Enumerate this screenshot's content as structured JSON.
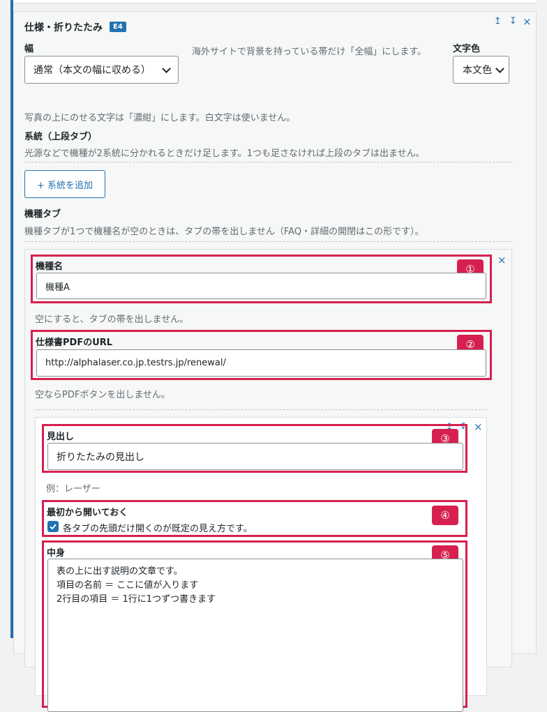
{
  "block": {
    "title": "仕様・折りたたみ",
    "badge": "E4",
    "controls": {
      "up": "↥",
      "down": "↧",
      "close": "×"
    }
  },
  "width_field": {
    "label": "幅",
    "value": "通常（本文の幅に収める）",
    "hint": "海外サイトで背景を持っている帯だけ「全幅」にします。"
  },
  "text_color_field": {
    "label": "文字色",
    "value": "本文色"
  },
  "photo_note": "写真の上にのせる文字は「濃紺」にします。白文字は使いません。",
  "system_section": {
    "label": "系統（上段タブ）",
    "desc": "光源などで機種が2系統に分かれるときだけ足します。1つも足さなければ上段のタブは出ません。",
    "add_button": "+ 系統を追加"
  },
  "model_tabs": {
    "label": "機種タブ",
    "desc": "機種タブが1つで機種名が空のときは、タブの帯を出しません（FAQ・詳細の開閉はこの形です）。"
  },
  "model_card": {
    "close": "×",
    "model_name": {
      "label": "機種名",
      "value": "機種A",
      "hint": "空にすると、タブの帯を出しません。",
      "marker": "①"
    },
    "pdf_url": {
      "label": "仕様書PDFのURL",
      "value": "http://alphalaser.co.jp.testrs.jp/renewal/",
      "hint": "空ならPDFボタンを出しません。",
      "marker": "②"
    }
  },
  "fold_card": {
    "controls": {
      "up": "↥",
      "down": "↧",
      "close": "×"
    },
    "heading": {
      "label": "見出し",
      "value": "折りたたみの見出し",
      "hint": "例：レーザー",
      "marker": "③"
    },
    "open_default": {
      "label": "最初から開いておく",
      "checkbox_label": "各タブの先頭だけ開くのが既定の見え方です。",
      "checked": true,
      "marker": "④"
    },
    "content": {
      "label": "中身",
      "value": "表の上に出す説明の文章です。\n項目の名前 ＝ ここに値が入ります\n2行目の項目 ＝ 1行に1つずつ書きます",
      "marker": "⑤"
    }
  },
  "colors": {
    "accent": "#2271b1",
    "highlight": "#d6204f"
  }
}
